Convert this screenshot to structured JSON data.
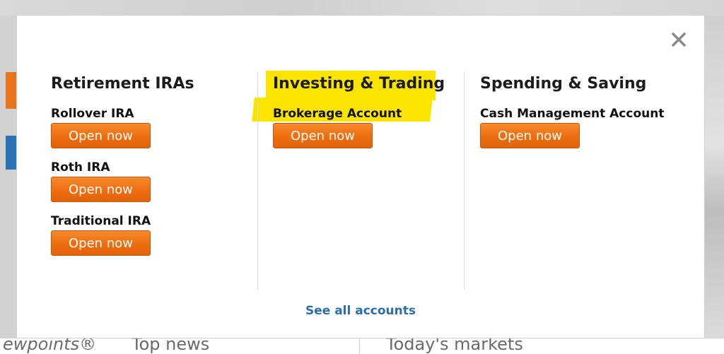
{
  "modal": {
    "close_label": "×",
    "columns": [
      {
        "title": "Retirement IRAs",
        "products": [
          {
            "name": "Rollover IRA",
            "button": "Open now"
          },
          {
            "name": "Roth IRA",
            "button": "Open now"
          },
          {
            "name": "Traditional IRA",
            "button": "Open now"
          }
        ]
      },
      {
        "title": "Investing & Trading",
        "highlighted": true,
        "products": [
          {
            "name": "Brokerage Account",
            "button": "Open now"
          }
        ]
      },
      {
        "title": "Spending & Saving",
        "products": [
          {
            "name": "Cash Management Account",
            "button": "Open now"
          }
        ]
      }
    ],
    "see_all_label": "See all accounts"
  },
  "background": {
    "viewpoints": "ewpoints®",
    "top_news": "Top news",
    "todays_markets": "Today's markets"
  },
  "colors": {
    "button_orange": "#ee6d0f",
    "highlight_yellow": "#fbe500",
    "link_blue": "#2a6db2"
  },
  "icons": {
    "close": "close-icon"
  }
}
